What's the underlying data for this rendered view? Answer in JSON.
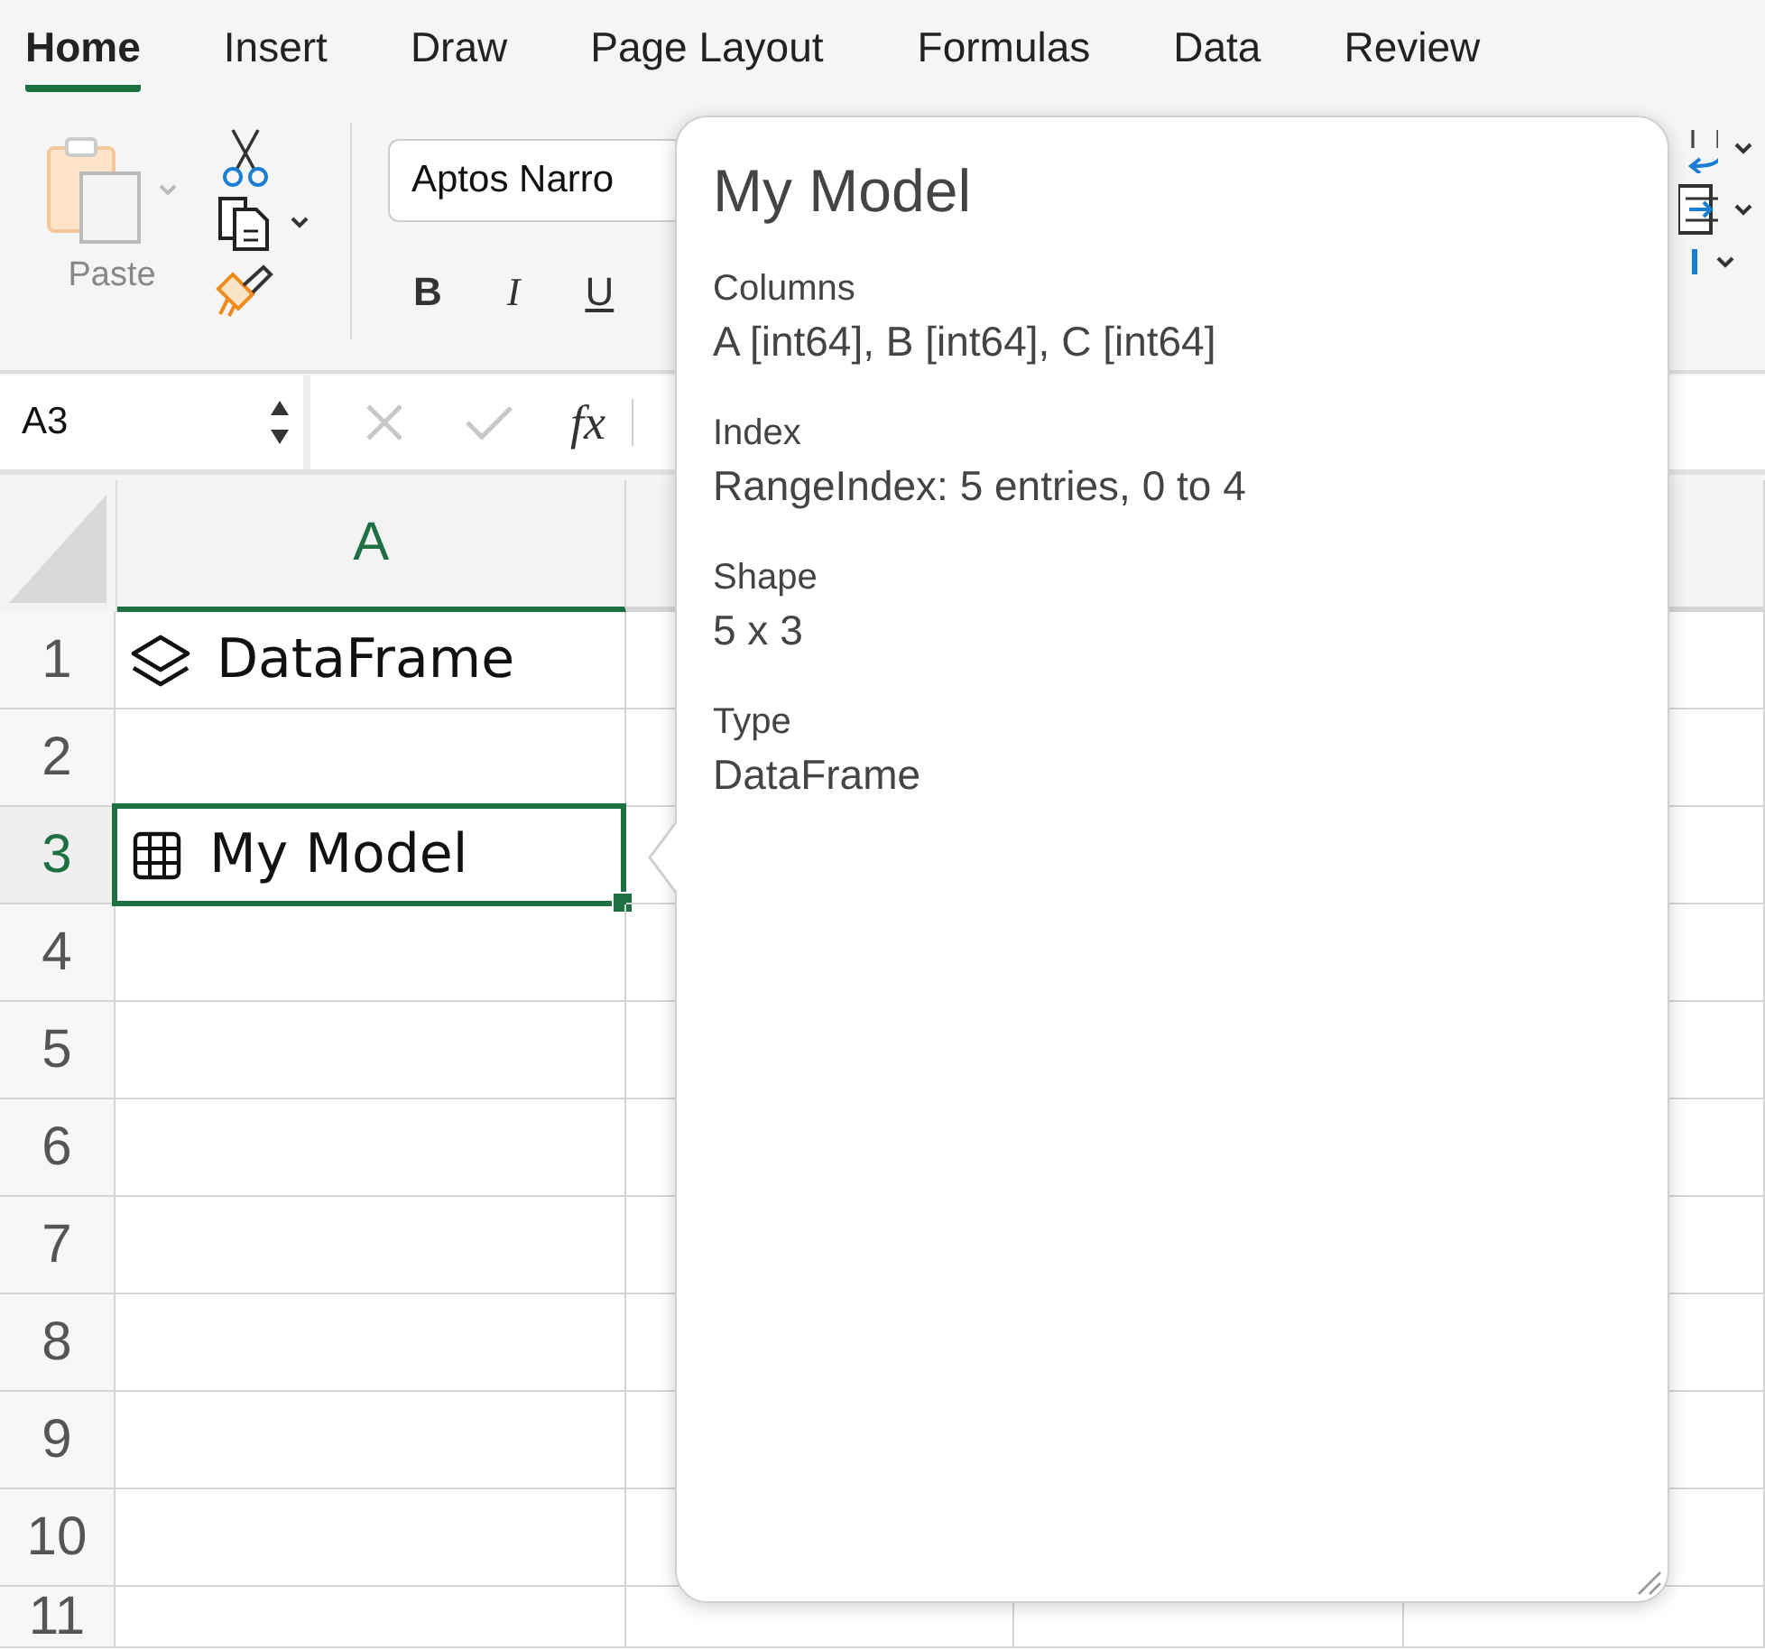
{
  "ribbon": {
    "tabs": [
      {
        "label": "Home",
        "selected": true
      },
      {
        "label": "Insert",
        "selected": false
      },
      {
        "label": "Draw",
        "selected": false
      },
      {
        "label": "Page Layout",
        "selected": false
      },
      {
        "label": "Formulas",
        "selected": false
      },
      {
        "label": "Data",
        "selected": false
      },
      {
        "label": "Review",
        "selected": false
      }
    ],
    "paste_label": "Paste",
    "font_name": "Aptos Narro",
    "format_buttons": [
      "B",
      "I",
      "U"
    ]
  },
  "formula_bar": {
    "name_box": "A3",
    "function_label": "fx"
  },
  "sheet": {
    "columns": [
      {
        "label": "A",
        "selected": true
      }
    ],
    "rows": [
      {
        "label": "1",
        "selected": false,
        "cell": {
          "text": "DataFrame",
          "kind": "layers"
        }
      },
      {
        "label": "2",
        "selected": false
      },
      {
        "label": "3",
        "selected": true,
        "cell": {
          "text": "My Model",
          "kind": "table"
        }
      },
      {
        "label": "4",
        "selected": false
      },
      {
        "label": "5",
        "selected": false
      },
      {
        "label": "6",
        "selected": false
      },
      {
        "label": "7",
        "selected": false
      },
      {
        "label": "8",
        "selected": false
      },
      {
        "label": "9",
        "selected": false
      },
      {
        "label": "10",
        "selected": false
      },
      {
        "label": "11",
        "selected": false
      }
    ]
  },
  "popover": {
    "title": "My Model",
    "fields": [
      {
        "label": "Columns",
        "value": "A [int64], B [int64], C [int64]"
      },
      {
        "label": "Index",
        "value": "RangeIndex: 5 entries, 0 to 4"
      },
      {
        "label": "Shape",
        "value": "5 x 3"
      },
      {
        "label": "Type",
        "value": "DataFrame"
      }
    ]
  }
}
